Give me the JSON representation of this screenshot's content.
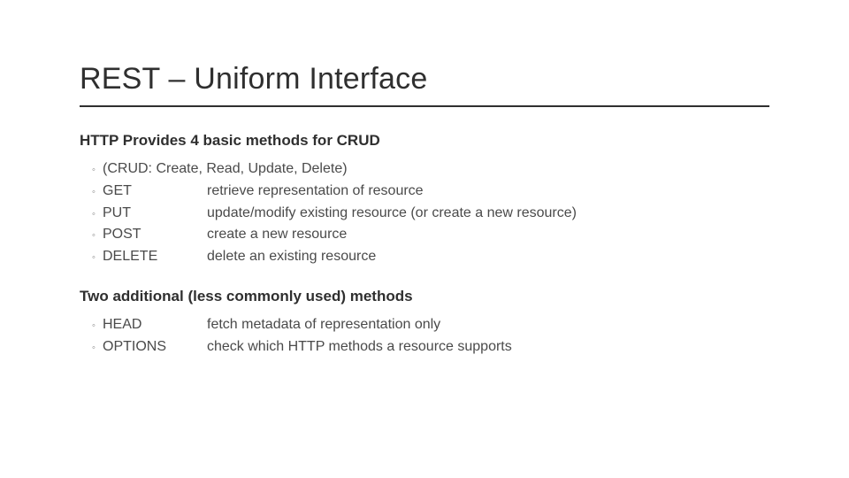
{
  "title": "REST – Uniform Interface",
  "section1": {
    "heading": "HTTP Provides 4 basic methods for CRUD",
    "intro": "(CRUD: Create, Read, Update, Delete)",
    "rows": [
      {
        "method": "GET",
        "desc": "retrieve representation of resource"
      },
      {
        "method": "PUT",
        "desc": "update/modify existing resource (or create a new resource)"
      },
      {
        "method": "POST",
        "desc": "create a new resource"
      },
      {
        "method": "DELETE",
        "desc": "delete an existing resource"
      }
    ]
  },
  "section2": {
    "heading": "Two additional (less commonly used) methods",
    "rows": [
      {
        "method": "HEAD",
        "desc": "fetch metadata of representation only"
      },
      {
        "method": "OPTIONS",
        "desc": "check which HTTP methods a resource supports"
      }
    ]
  },
  "bullet": "◦"
}
